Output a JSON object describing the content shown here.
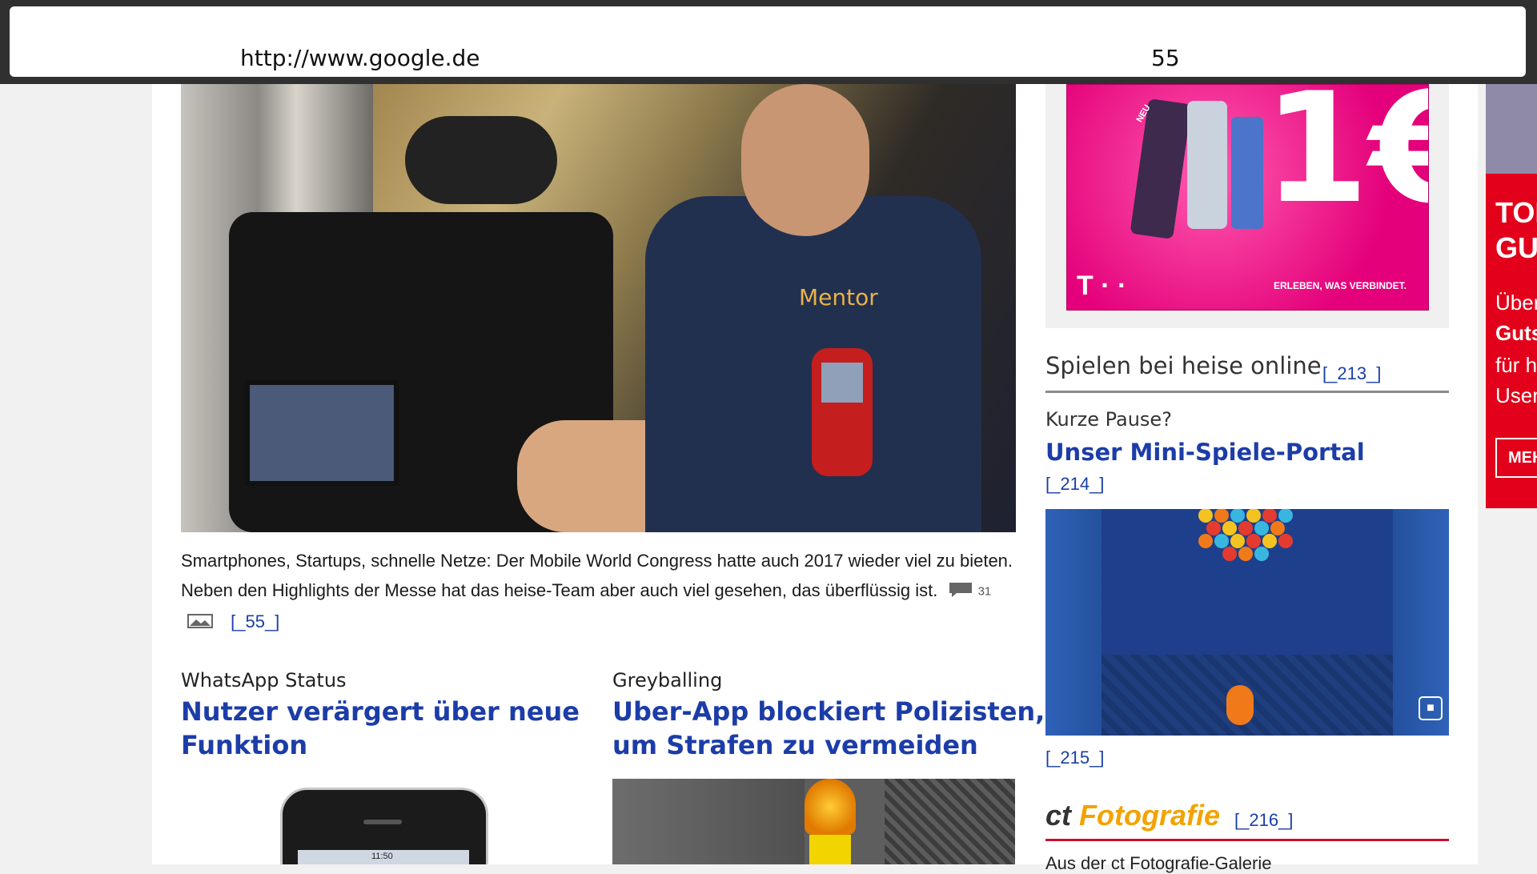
{
  "browser": {
    "url": "http://www.google.de",
    "tab_count": "55"
  },
  "main_article": {
    "caption": "Smartphones, Startups, schnelle Netze: Der Mobile World Congress hatte auch 2017 wieder viel zu bieten. Neben den Highlights der Messe hat das heise-Team aber auch viel gesehen, das überflüssig ist.",
    "comment_count": "31",
    "ref": "[_55_]",
    "hero_text": "Mentor"
  },
  "articles": [
    {
      "kicker": "WhatsApp Status",
      "title_line1": "Nutzer verärgert über neue",
      "title_line2": "Funktion"
    },
    {
      "kicker": "Greyballing",
      "title_line1": "Uber-App blockiert Polizisten,",
      "title_line2": "um Strafen zu vermeiden"
    }
  ],
  "sidebar": {
    "ad": {
      "price": "1€",
      "slogan": "ERLEBEN, WAS VERBINDET.",
      "brand": "T · ·",
      "badge": "NEU"
    },
    "games": {
      "section_title": "Spielen bei heise online",
      "section_ref": "[_213_]",
      "kicker": "Kurze Pause?",
      "title": "Unser Mini-Spiele-Portal",
      "ref": "[_214_]",
      "image_ref": "[_215_]"
    },
    "ct": {
      "logo_ct": "ct",
      "logo_foto": "Fotografie",
      "ref": "[_216_]",
      "subtitle": "Aus der ct Fotografie-Galerie"
    }
  },
  "side_ad": {
    "line1": "TOP",
    "line2": "GUT",
    "line3": "Über",
    "line4": "Guts",
    "line5": "für h",
    "line6": "User",
    "button": "MEH"
  },
  "iphone_time": "11:50",
  "colors": {
    "link": "#1c3da8",
    "telekom_magenta": "#e4007a",
    "ct_red": "#c8102e",
    "ct_orange": "#f3a200"
  }
}
